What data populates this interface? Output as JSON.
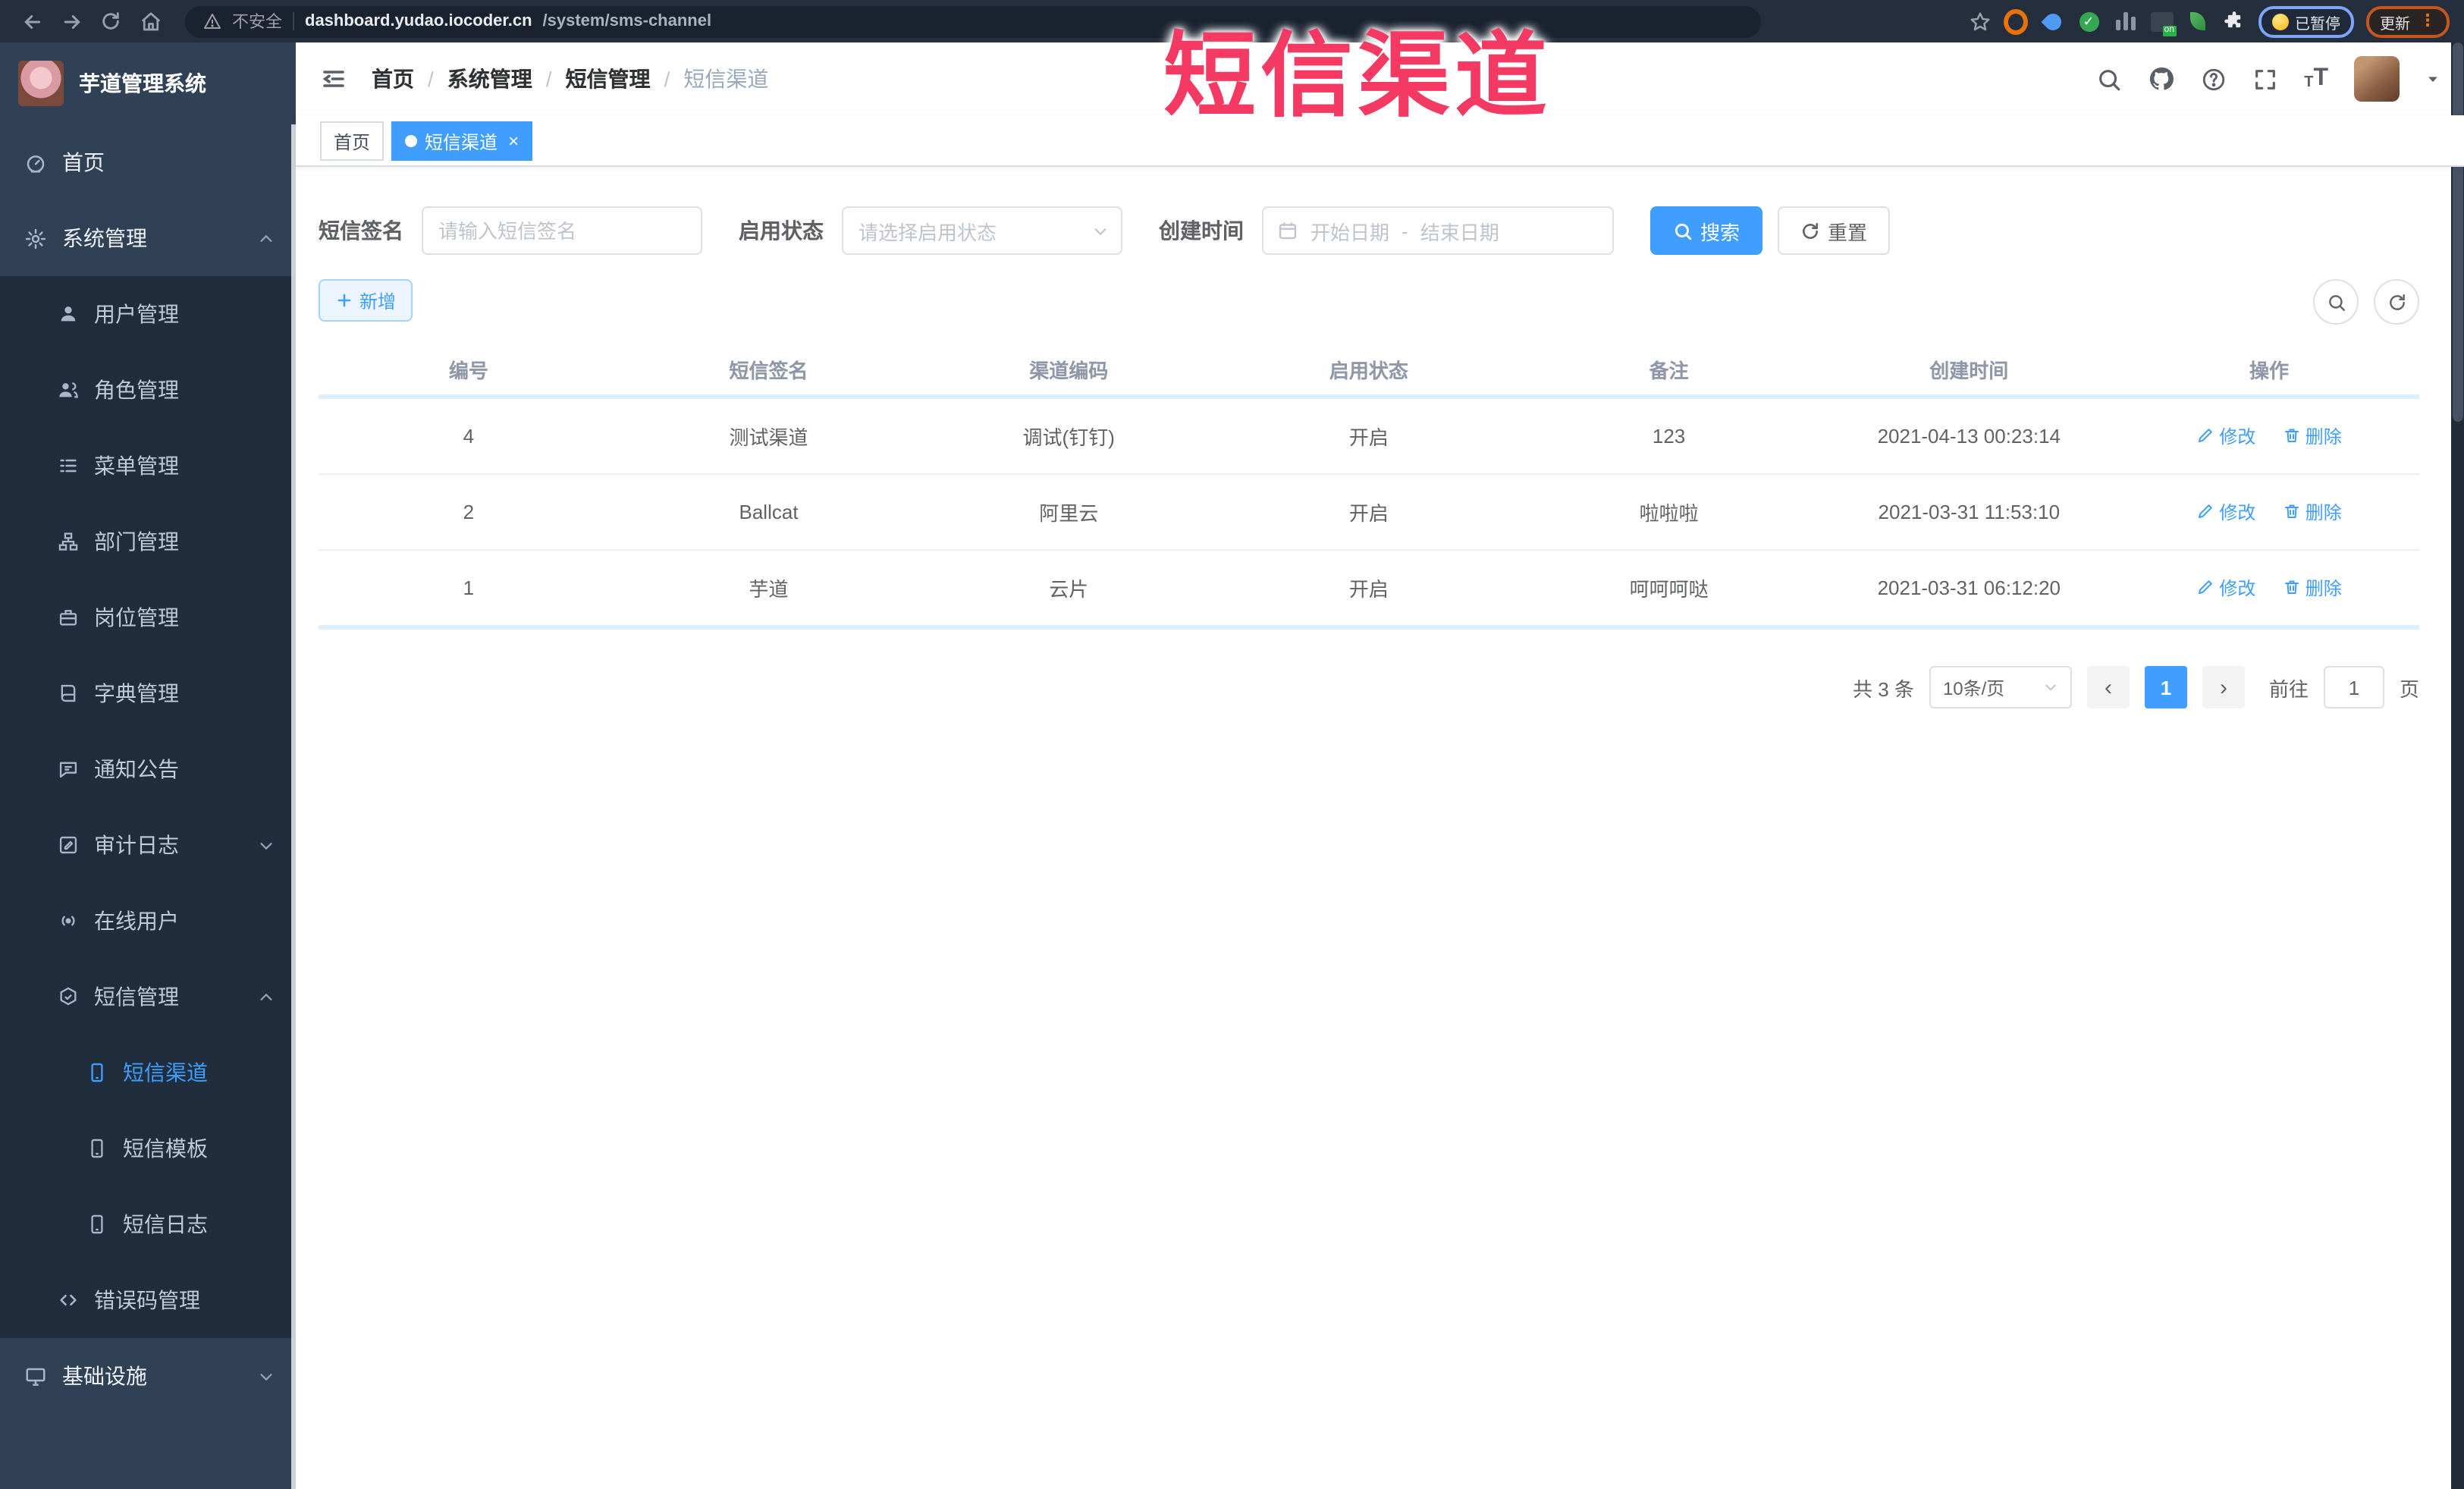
{
  "browser": {
    "security_label": "不安全",
    "url_domain": "dashboard.yudao.iocoder.cn",
    "url_path": "/system/sms-channel",
    "paused_badge": "已暂停",
    "update_label": "更新"
  },
  "overlay": {
    "title": "短信渠道",
    "color": "#f43a63"
  },
  "sidebar": {
    "logo_title": "芋道管理系统",
    "items": [
      {
        "label": "首页",
        "icon": "dashboard-icon",
        "level": 1
      },
      {
        "label": "系统管理",
        "icon": "gear-icon",
        "level": 1,
        "state": "expanded"
      },
      {
        "label": "用户管理",
        "icon": "user-icon",
        "level": 2
      },
      {
        "label": "角色管理",
        "icon": "roles-icon",
        "level": 2
      },
      {
        "label": "菜单管理",
        "icon": "menu-list-icon",
        "level": 2
      },
      {
        "label": "部门管理",
        "icon": "org-tree-icon",
        "level": 2
      },
      {
        "label": "岗位管理",
        "icon": "post-icon",
        "level": 2
      },
      {
        "label": "字典管理",
        "icon": "dict-icon",
        "level": 2
      },
      {
        "label": "通知公告",
        "icon": "announcement-icon",
        "level": 2
      },
      {
        "label": "审计日志",
        "icon": "audit-log-icon",
        "level": 2,
        "state": "collapsed"
      },
      {
        "label": "在线用户",
        "icon": "online-users-icon",
        "level": 2
      },
      {
        "label": "短信管理",
        "icon": "sms-icon",
        "level": 2,
        "state": "expanded"
      },
      {
        "label": "短信渠道",
        "icon": "phone-icon",
        "level": 3,
        "active": true
      },
      {
        "label": "短信模板",
        "icon": "phone-icon",
        "level": 3
      },
      {
        "label": "短信日志",
        "icon": "phone-icon",
        "level": 3
      },
      {
        "label": "错误码管理",
        "icon": "code-icon",
        "level": 2
      },
      {
        "label": "基础设施",
        "icon": "monitor-icon",
        "level": 1,
        "state": "collapsed"
      }
    ]
  },
  "header": {
    "breadcrumb": [
      "首页",
      "系统管理",
      "短信管理",
      "短信渠道"
    ]
  },
  "tabs": [
    {
      "label": "首页",
      "active": false
    },
    {
      "label": "短信渠道",
      "active": true,
      "close": "×"
    }
  ],
  "filters": {
    "sign_label": "短信签名",
    "sign_placeholder": "请输入短信签名",
    "status_label": "启用状态",
    "status_placeholder": "请选择启用状态",
    "time_label": "创建时间",
    "start_placeholder": "开始日期",
    "range_separator": "-",
    "end_placeholder": "结束日期",
    "search_label": "搜索",
    "reset_label": "重置"
  },
  "toolbar": {
    "add_label": "新增"
  },
  "table": {
    "columns": [
      "编号",
      "短信签名",
      "渠道编码",
      "启用状态",
      "备注",
      "创建时间",
      "操作"
    ],
    "rows": [
      {
        "id": "4",
        "signature": "测试渠道",
        "code": "调试(钉钉)",
        "status": "开启",
        "remark": "123",
        "created_at": "2021-04-13 00:23:14"
      },
      {
        "id": "2",
        "signature": "Ballcat",
        "code": "阿里云",
        "status": "开启",
        "remark": "啦啦啦",
        "created_at": "2021-03-31 11:53:10"
      },
      {
        "id": "1",
        "signature": "芋道",
        "code": "云片",
        "status": "开启",
        "remark": "呵呵呵哒",
        "created_at": "2021-03-31 06:12:20"
      }
    ],
    "edit_label": "修改",
    "delete_label": "删除"
  },
  "pagination": {
    "total": "共 3 条",
    "page_size": "10条/页",
    "prev": "‹",
    "page": "1",
    "next": "›",
    "goto_label": "前往",
    "goto_value": "1",
    "page_unit": "页"
  },
  "colors": {
    "primary": "#409eff",
    "sidebar_bg": "#304156",
    "submenu_bg": "#1f2d3d",
    "overlay_red": "#f43a63"
  }
}
